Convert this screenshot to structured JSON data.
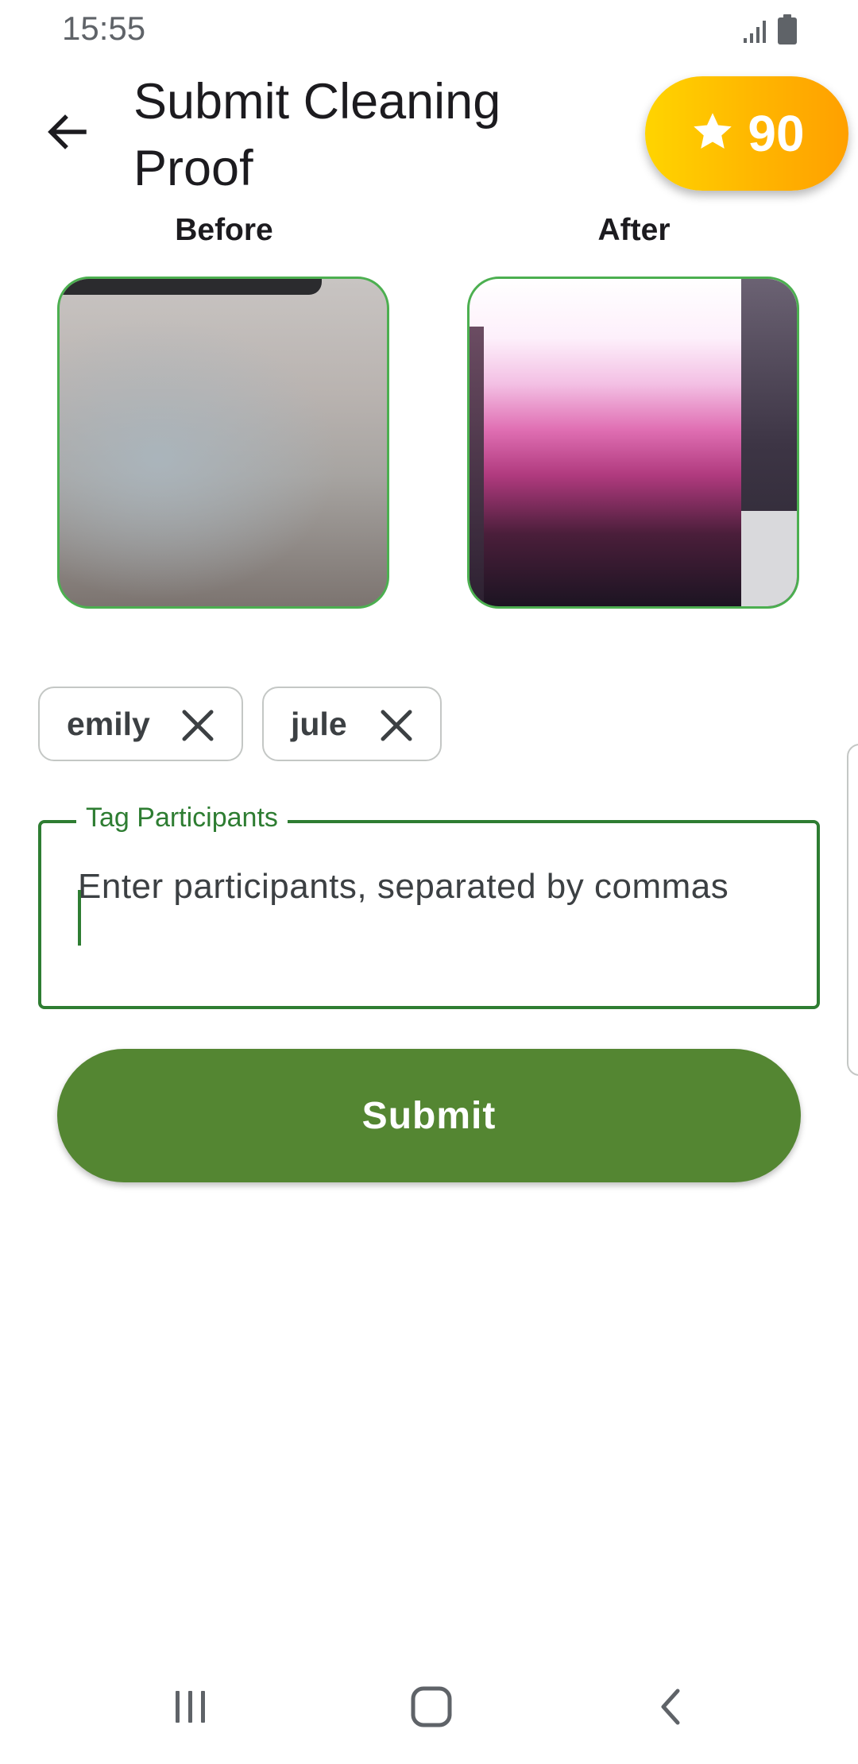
{
  "status_bar": {
    "time": "15:55",
    "icons": [
      "signal-icon",
      "battery-icon"
    ]
  },
  "header": {
    "back_icon": "arrow-left-icon",
    "title": "Submit Cleaning Proof",
    "points": {
      "icon": "star-icon",
      "value": "90"
    }
  },
  "photos": {
    "before_label": "Before",
    "after_label": "After"
  },
  "participants": {
    "chips": [
      {
        "label": "emily",
        "remove_icon": "close-icon"
      },
      {
        "label": "jule",
        "remove_icon": "close-icon"
      }
    ],
    "field": {
      "label": "Tag Participants",
      "placeholder": "Enter participants, separated by commas",
      "value": ""
    }
  },
  "actions": {
    "submit_label": "Submit"
  },
  "nav_bar": {
    "icons": [
      "recent-apps-icon",
      "home-icon",
      "back-icon"
    ]
  },
  "colors": {
    "accent_green": "#2e7d32",
    "button_green": "#548632",
    "photo_border": "#4caf50",
    "badge_gold": "#ffc107"
  }
}
